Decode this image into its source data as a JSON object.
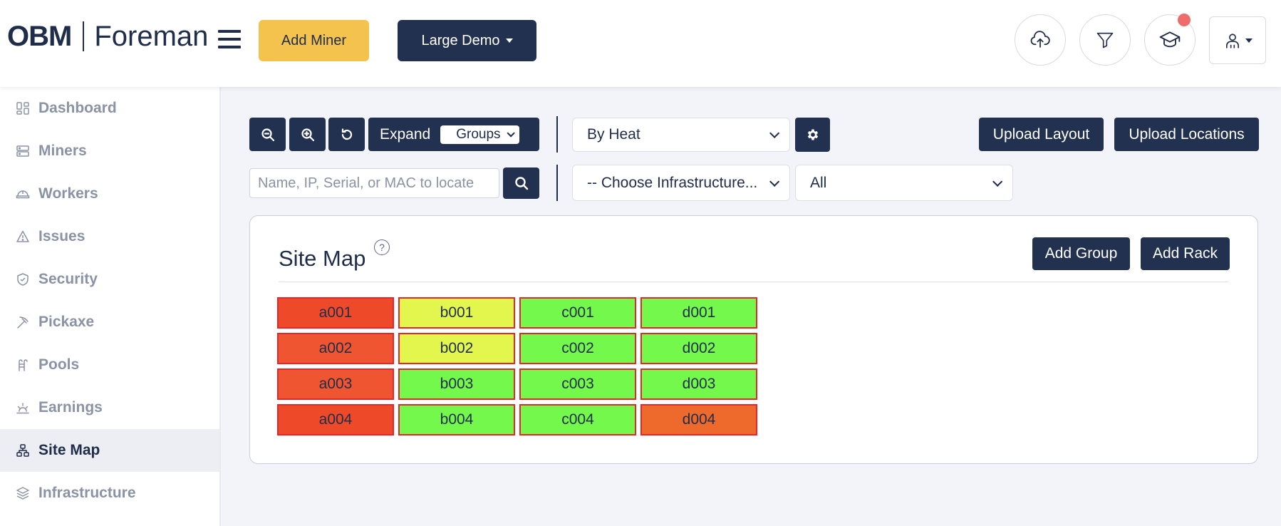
{
  "header": {
    "logo_brand": "OBM",
    "logo_product": "Foreman",
    "add_miner_label": "Add Miner",
    "site_selector_label": "Large Demo",
    "icons": [
      "cloud-upload-icon",
      "filter-icon",
      "graduation-cap-icon",
      "user-icon"
    ],
    "notification_color": "#ee6c6c"
  },
  "sidebar": {
    "items": [
      {
        "label": "Dashboard",
        "icon": "dashboard-icon"
      },
      {
        "label": "Miners",
        "icon": "server-icon"
      },
      {
        "label": "Workers",
        "icon": "helmet-icon"
      },
      {
        "label": "Issues",
        "icon": "warning-icon"
      },
      {
        "label": "Security",
        "icon": "shield-icon"
      },
      {
        "label": "Pickaxe",
        "icon": "pickaxe-icon"
      },
      {
        "label": "Pools",
        "icon": "pool-icon"
      },
      {
        "label": "Earnings",
        "icon": "sunrise-icon"
      },
      {
        "label": "Site Map",
        "icon": "sitemap-icon",
        "active": true
      },
      {
        "label": "Infrastructure",
        "icon": "layers-icon"
      }
    ]
  },
  "toolbar": {
    "expand_label": "Expand",
    "groups_label": "Groups",
    "view_mode": "By Heat",
    "upload_layout_label": "Upload Layout",
    "upload_locations_label": "Upload Locations",
    "search_placeholder": "Name, IP, Serial, or MAC to locate",
    "infrastructure_placeholder": "-- Choose Infrastructure...",
    "filter_value": "All"
  },
  "site_map": {
    "title": "Site Map",
    "help_glyph": "?",
    "add_group_label": "Add Group",
    "add_rack_label": "Add Rack",
    "racks": [
      {
        "name": "a001",
        "color": "#ee4a2a"
      },
      {
        "name": "b001",
        "color": "#e3f64d"
      },
      {
        "name": "c001",
        "color": "#74f84b"
      },
      {
        "name": "d001",
        "color": "#74f84b"
      },
      {
        "name": "a002",
        "color": "#ee5530"
      },
      {
        "name": "b002",
        "color": "#e3f64d"
      },
      {
        "name": "c002",
        "color": "#74f84b"
      },
      {
        "name": "d002",
        "color": "#74f84b"
      },
      {
        "name": "a003",
        "color": "#ee5530"
      },
      {
        "name": "b003",
        "color": "#74f84b"
      },
      {
        "name": "c003",
        "color": "#74f84b"
      },
      {
        "name": "d003",
        "color": "#74f84b"
      },
      {
        "name": "a004",
        "color": "#ee4a2a"
      },
      {
        "name": "b004",
        "color": "#74f84b"
      },
      {
        "name": "c004",
        "color": "#74f84b"
      },
      {
        "name": "d004",
        "color": "#ee692c"
      }
    ]
  },
  "colors": {
    "navy": "#223150",
    "accent_yellow": "#f3c34d",
    "rack_border": "#e8262a"
  }
}
